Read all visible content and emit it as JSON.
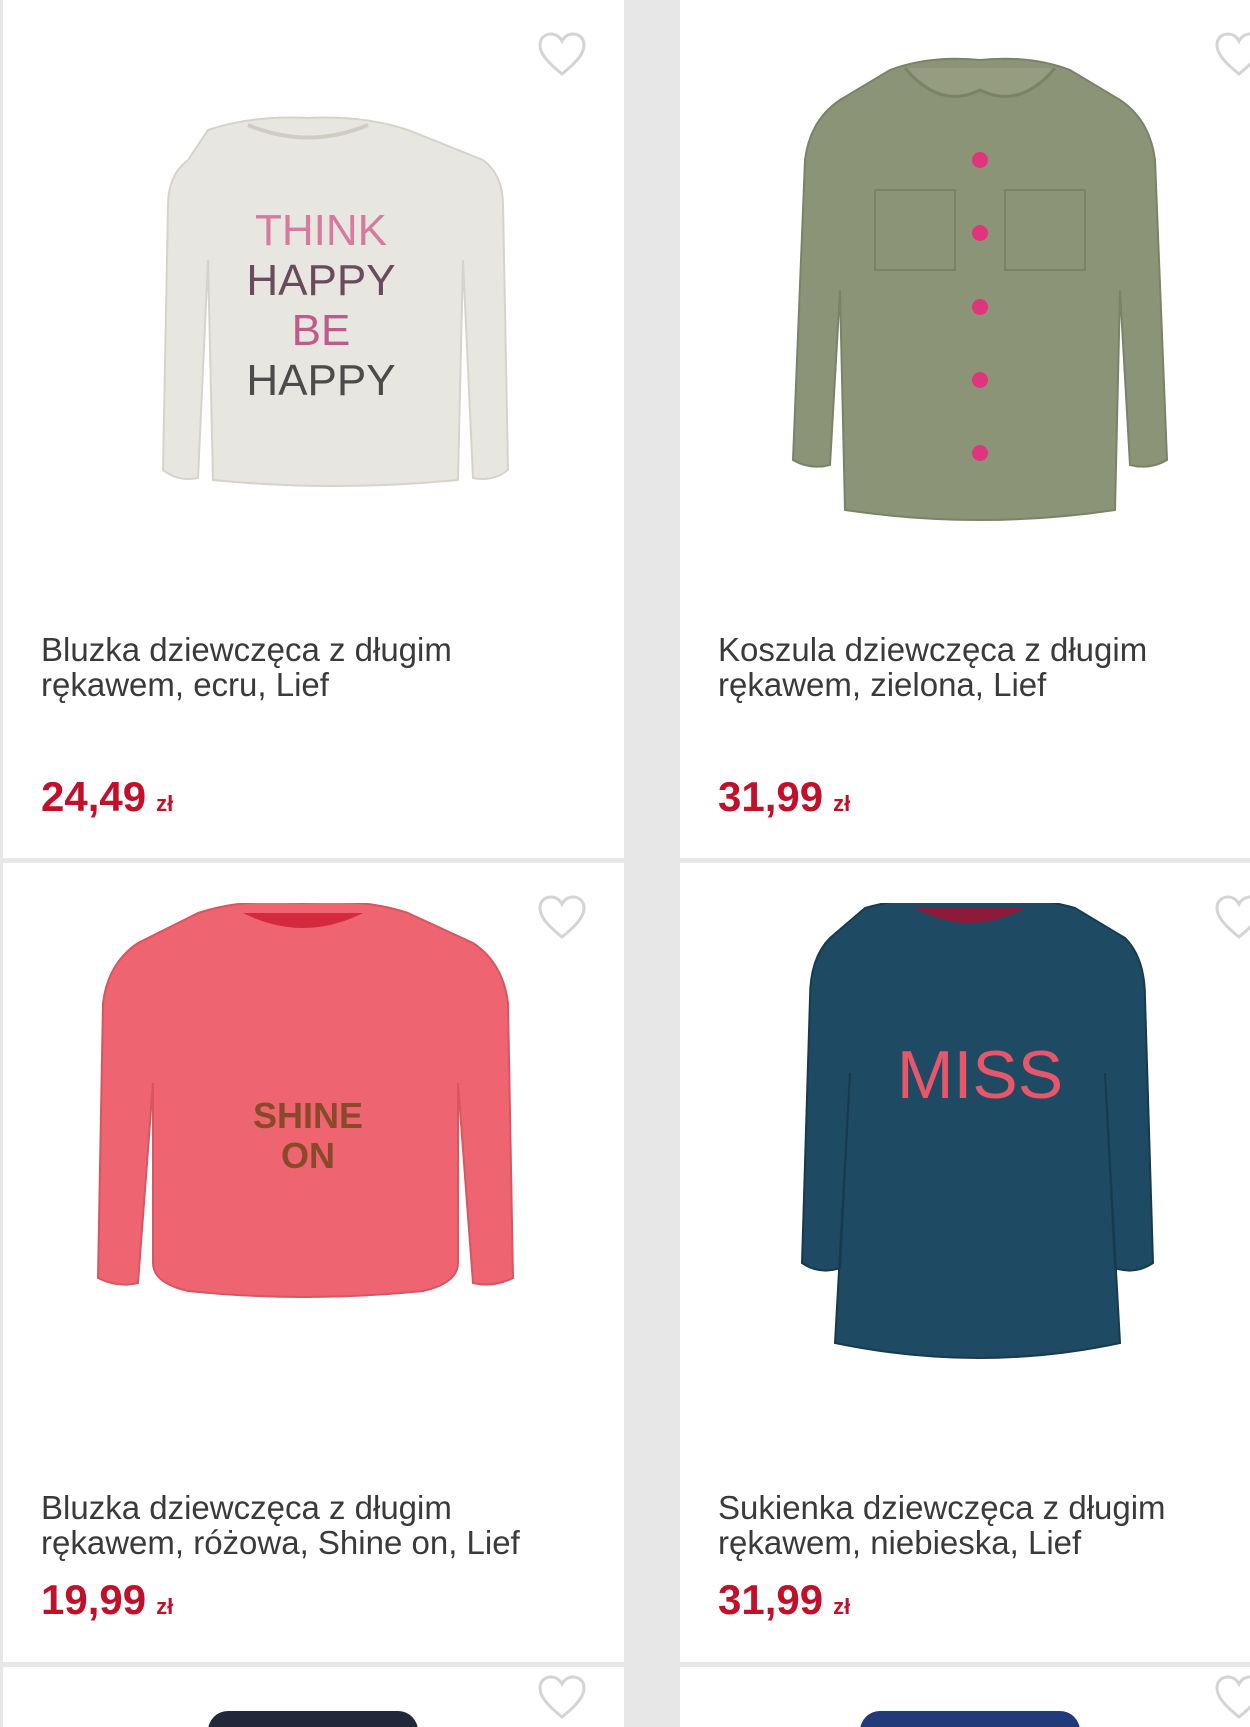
{
  "products": [
    {
      "title_line1": "Bluzka dziewczęca z długim",
      "title_line2": "rękawem, ecru, Lief",
      "price": "24,49",
      "currency": "zł",
      "image_text": [
        "THINK",
        "HAPPY",
        "BE",
        "HAPPY"
      ],
      "color": "#e8e6e1"
    },
    {
      "title_line1": "Koszula dziewczęca z długim",
      "title_line2": "rękawem, zielona, Lief",
      "price": "31,99",
      "currency": "zł",
      "color": "#8c9478"
    },
    {
      "title_line1": "Bluzka dziewczęca z długim",
      "title_line2": "rękawem, różowa, Shine on, Lief",
      "price": "19,99",
      "currency": "zł",
      "image_text": [
        "SHINE",
        "ON"
      ],
      "color": "#ee6470"
    },
    {
      "title_line1": "Sukienka dziewczęca z długim",
      "title_line2": "rękawem, niebieska, Lief",
      "price": "31,99",
      "currency": "zł",
      "image_text": [
        "MISS"
      ],
      "color": "#1f4a63"
    }
  ],
  "icons": {
    "wishlist": "heart-outline-icon"
  },
  "colors": {
    "price": "#c0102a",
    "text": "#3a3a3a",
    "background": "#e7e7e7"
  }
}
